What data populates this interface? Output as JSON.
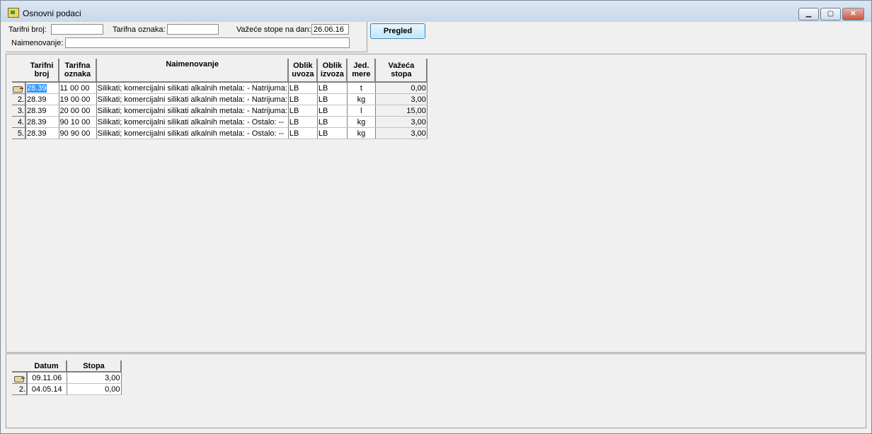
{
  "window": {
    "title": "Osnovni podaci",
    "min_glyph": "▁",
    "max_glyph": "▢",
    "close_glyph": "✕"
  },
  "filters": {
    "tarifni_broj_label": "Tarifni broj:",
    "tarifni_broj_value": "",
    "tarifna_oznaka_label": "Tarifna oznaka:",
    "tarifna_oznaka_value": "",
    "vazece_label": "Važeće stope na dan:",
    "vazece_value": "26.06.16",
    "naimenovanje_label": "Naimenovanje:",
    "naimenovanje_value": "",
    "pregled_button": "Pregled"
  },
  "main_table": {
    "headers": {
      "tarifni_broj": [
        "Tarifni",
        "broj"
      ],
      "tarifna_oznaka": [
        "Tarifna",
        "oznaka"
      ],
      "naimenovanje": "Naimenovanje",
      "oblik_uvoza": [
        "Oblik",
        "uvoza"
      ],
      "oblik_izvoza": [
        "Oblik",
        "izvoza"
      ],
      "jed_mere": [
        "Jed.",
        "mere"
      ],
      "vazeca_stopa": [
        "Važeća",
        "stopa"
      ]
    },
    "rows": [
      {
        "num": "",
        "tarifni_broj": "28.39",
        "tarifna_oznaka": "11 00 00",
        "naimenovanje": "Silikati; komercijalni silikati alkalnih metala: - Natrijuma:",
        "oblik_uvoza": "LB",
        "oblik_izvoza": "LB",
        "jed_mere": "t",
        "vazeca_stopa": "0,00"
      },
      {
        "num": "2.",
        "tarifni_broj": "28.39",
        "tarifna_oznaka": "19 00 00",
        "naimenovanje": "Silikati; komercijalni silikati alkalnih metala: - Natrijuma:",
        "oblik_uvoza": "LB",
        "oblik_izvoza": "LB",
        "jed_mere": "kg",
        "vazeca_stopa": "3,00"
      },
      {
        "num": "3.",
        "tarifni_broj": "28.39",
        "tarifna_oznaka": "20 00 00",
        "naimenovanje": "Silikati; komercijalni silikati alkalnih metala: - Natrijuma:",
        "oblik_uvoza": "LB",
        "oblik_izvoza": "LB",
        "jed_mere": "l",
        "vazeca_stopa": "15,00"
      },
      {
        "num": "4.",
        "tarifni_broj": "28.39",
        "tarifna_oznaka": "90 10 00",
        "naimenovanje": "Silikati; komercijalni silikati alkalnih metala: - Ostalo: --",
        "oblik_uvoza": "LB",
        "oblik_izvoza": "LB",
        "jed_mere": "kg",
        "vazeca_stopa": "3,00"
      },
      {
        "num": "5.",
        "tarifni_broj": "28.39",
        "tarifna_oznaka": "90 90 00",
        "naimenovanje": "Silikati; komercijalni silikati alkalnih metala: - Ostalo: --",
        "oblik_uvoza": "LB",
        "oblik_izvoza": "LB",
        "jed_mere": "kg",
        "vazeca_stopa": "3,00"
      }
    ]
  },
  "bottom_table": {
    "headers": {
      "datum": "Datum",
      "stopa": "Stopa"
    },
    "rows": [
      {
        "num": "",
        "datum": "09.11.06",
        "stopa": "3,00"
      },
      {
        "num": "2.",
        "datum": "04.05.14",
        "stopa": "0,00"
      }
    ]
  },
  "icons": {
    "window_icon": "app-icon",
    "current_row_icon": "pointing-hand-icon"
  }
}
